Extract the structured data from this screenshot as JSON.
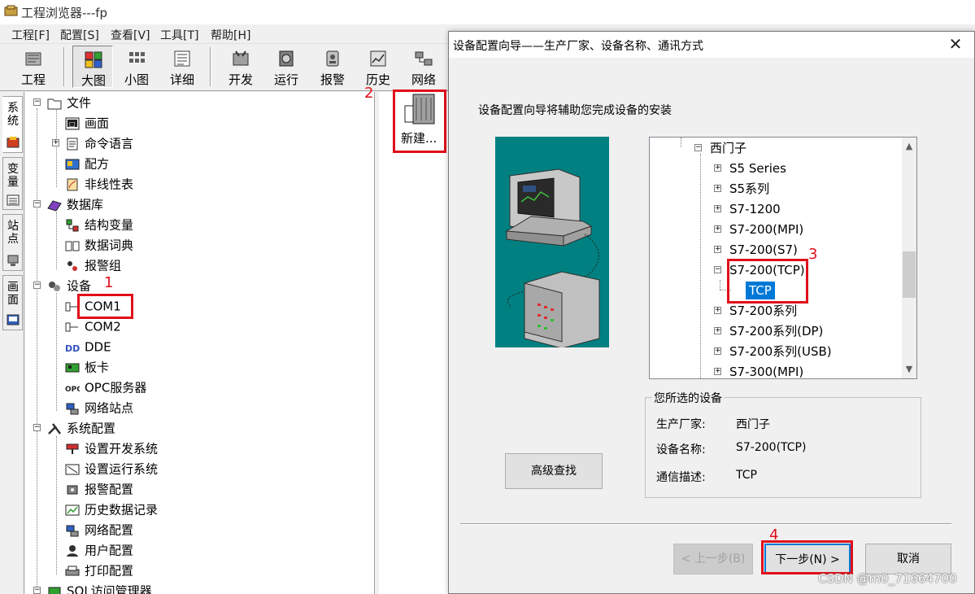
{
  "window": {
    "title": "工程浏览器---fp"
  },
  "menu": [
    {
      "label": "工程[F]"
    },
    {
      "label": "配置[S]"
    },
    {
      "label": "查看[V]"
    },
    {
      "label": "工具[T]"
    },
    {
      "label": "帮助[H]"
    }
  ],
  "toolbar": [
    {
      "label": "工程",
      "icon": "project-icon"
    },
    {
      "label": "大图",
      "icon": "large-icons-icon"
    },
    {
      "label": "小图",
      "icon": "small-icons-icon"
    },
    {
      "label": "详细",
      "icon": "details-icon"
    },
    {
      "label": "开发",
      "icon": "develop-icon"
    },
    {
      "label": "运行",
      "icon": "run-icon"
    },
    {
      "label": "报警",
      "icon": "alarm-icon"
    },
    {
      "label": "历史",
      "icon": "history-icon"
    },
    {
      "label": "网络",
      "icon": "network-icon"
    }
  ],
  "side_tabs": [
    {
      "label": "系统"
    },
    {
      "label": "变量"
    },
    {
      "label": "站点"
    },
    {
      "label": "画面"
    }
  ],
  "tree": {
    "file": "文件",
    "screen": "画面",
    "command_lang": "命令语言",
    "recipe": "配方",
    "nonlinear": "非线性表",
    "database": "数据库",
    "struct_var": "结构变量",
    "data_dict": "数据词典",
    "alarm_group": "报警组",
    "devices": "设备",
    "com1": "COM1",
    "com2": "COM2",
    "dde": "DDE",
    "board": "板卡",
    "opc": "OPC服务器",
    "net_station": "网络站点",
    "sys_config": "系统配置",
    "dev_sys": "设置开发系统",
    "run_sys": "设置运行系统",
    "alarm_cfg": "报警配置",
    "hist_rec": "历史数据记录",
    "net_cfg": "网络配置",
    "user_cfg": "用户配置",
    "print_cfg": "打印配置",
    "sql": "SQL访问管理器"
  },
  "right_pane": {
    "new_item": "新建..."
  },
  "annotations": [
    "1",
    "2",
    "3",
    "4"
  ],
  "dialog": {
    "title": "设备配置向导——生产厂家、设备名称、通讯方式",
    "close": "✕",
    "intro": "设备配置向导将辅助您完成设备的安装",
    "device_tree": [
      {
        "label": "西门子",
        "level": 0,
        "expander": "−"
      },
      {
        "label": "S5 Series",
        "level": 1,
        "expander": "+"
      },
      {
        "label": "S5系列",
        "level": 1,
        "expander": "+"
      },
      {
        "label": "S7-1200",
        "level": 1,
        "expander": "+"
      },
      {
        "label": "S7-200(MPI)",
        "level": 1,
        "expander": "+"
      },
      {
        "label": "S7-200(S7)",
        "level": 1,
        "expander": "+"
      },
      {
        "label": "S7-200(TCP)",
        "level": 1,
        "expander": "−"
      },
      {
        "label": "TCP",
        "level": 2,
        "expander": "",
        "selected": true
      },
      {
        "label": "S7-200系列",
        "level": 1,
        "expander": "+"
      },
      {
        "label": "S7-200系列(DP)",
        "level": 1,
        "expander": "+"
      },
      {
        "label": "S7-200系列(USB)",
        "level": 1,
        "expander": "+"
      },
      {
        "label": "S7-300(MPI)",
        "level": 1,
        "expander": "+"
      }
    ],
    "selected_group": {
      "title": "您所选的设备",
      "manufacturer_label": "生产厂家:",
      "manufacturer": "西门子",
      "device_label": "设备名称:",
      "device": "S7-200(TCP)",
      "comm_label": "通信描述:",
      "comm": "TCP"
    },
    "buttons": {
      "advanced": "高级查找",
      "prev": "< 上一步(B)",
      "next": "下一步(N) >",
      "cancel": "取消"
    }
  },
  "watermark": "CSDN @m0_71664700",
  "colors": {
    "selection": "#0078d7",
    "annotation": "#e0101a",
    "wizard_bg": "#008080"
  }
}
